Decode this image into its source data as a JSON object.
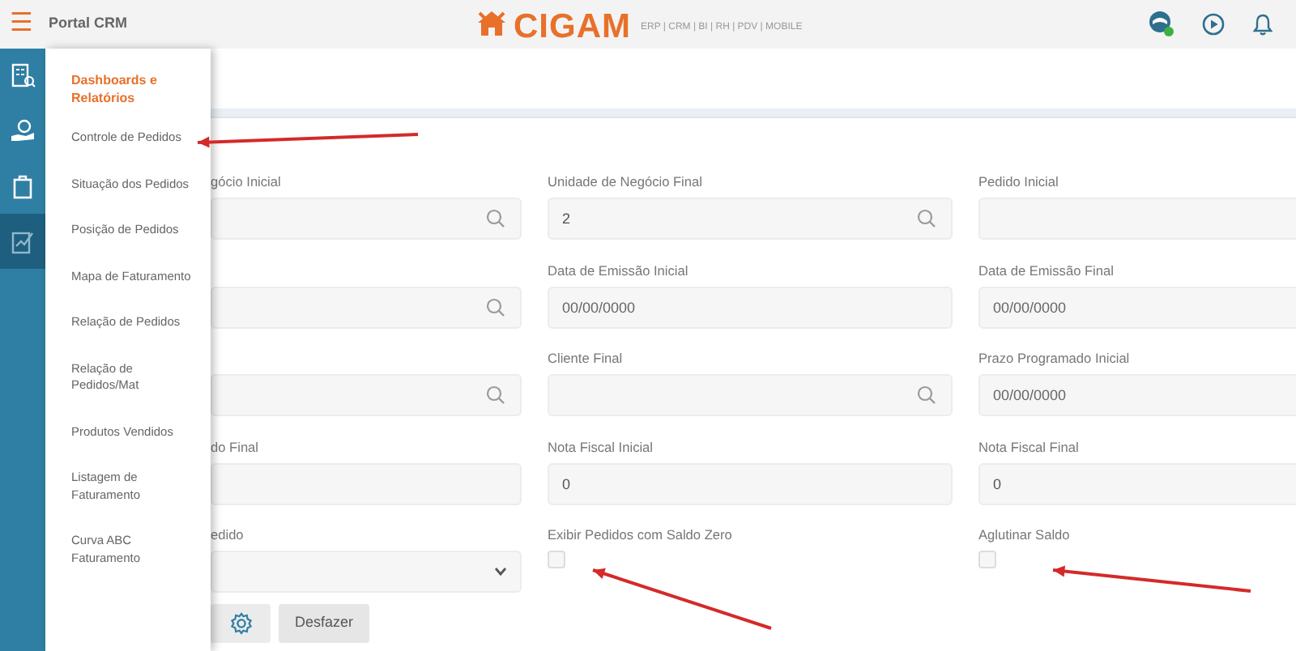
{
  "topbar": {
    "menu_glyph": "☰",
    "title": "Portal CRM",
    "logo": "CIGAM",
    "tagline": "ERP | CRM | BI | RH | PDV | MOBILE",
    "user_online": true
  },
  "rail": [
    {
      "selected": false
    },
    {
      "selected": false
    },
    {
      "selected": false
    },
    {
      "selected": true
    }
  ],
  "menu": {
    "heading": "Dashboards e Relatórios",
    "items": [
      {
        "label": "Controle de Pedidos"
      },
      {
        "label": "Situação dos Pedidos"
      },
      {
        "label": "Posição de Pedidos"
      },
      {
        "label": "Mapa de Faturamento"
      },
      {
        "label": "Relação de Pedidos"
      },
      {
        "label": "Relação de Pedidos/Mat"
      },
      {
        "label": "Produtos Vendidos"
      },
      {
        "label": "Listagem de Faturamento"
      },
      {
        "label": "Curva ABC Faturamento"
      }
    ]
  },
  "form": {
    "fields": [
      {
        "kind": "search",
        "label": "gócio Inicial"
      },
      {
        "kind": "search",
        "label": "Unidade de Negócio Final",
        "value": "2"
      },
      {
        "kind": "text",
        "label": "Pedido Inicial"
      },
      {
        "kind": "search"
      },
      {
        "kind": "text",
        "label": "Data de Emissão Inicial",
        "placeholder": "00/00/0000"
      },
      {
        "kind": "text",
        "label": "Data de Emissão Final",
        "placeholder": "00/00/0000"
      },
      {
        "kind": "search"
      },
      {
        "kind": "search",
        "label": "Cliente Final"
      },
      {
        "kind": "text",
        "label": "Prazo Programado Inicial",
        "placeholder": "00/00/0000"
      },
      {
        "kind": "text",
        "label": "do Final"
      },
      {
        "kind": "text",
        "label": "Nota Fiscal Inicial",
        "value": "0"
      },
      {
        "kind": "text",
        "label": "Nota Fiscal Final",
        "value": "0"
      },
      {
        "kind": "select",
        "label": "edido"
      },
      {
        "kind": "checkbox",
        "label": "Exibir Pedidos com Saldo Zero",
        "checked": false
      },
      {
        "kind": "checkbox",
        "label": "Aglutinar Saldo",
        "checked": false
      }
    ],
    "buttons": [
      {
        "kind": "settings"
      },
      {
        "kind": "text",
        "label": "Desfazer"
      }
    ]
  },
  "annotations": [
    {
      "kind": "arrow"
    },
    {
      "kind": "arrow"
    },
    {
      "kind": "arrow"
    }
  ]
}
